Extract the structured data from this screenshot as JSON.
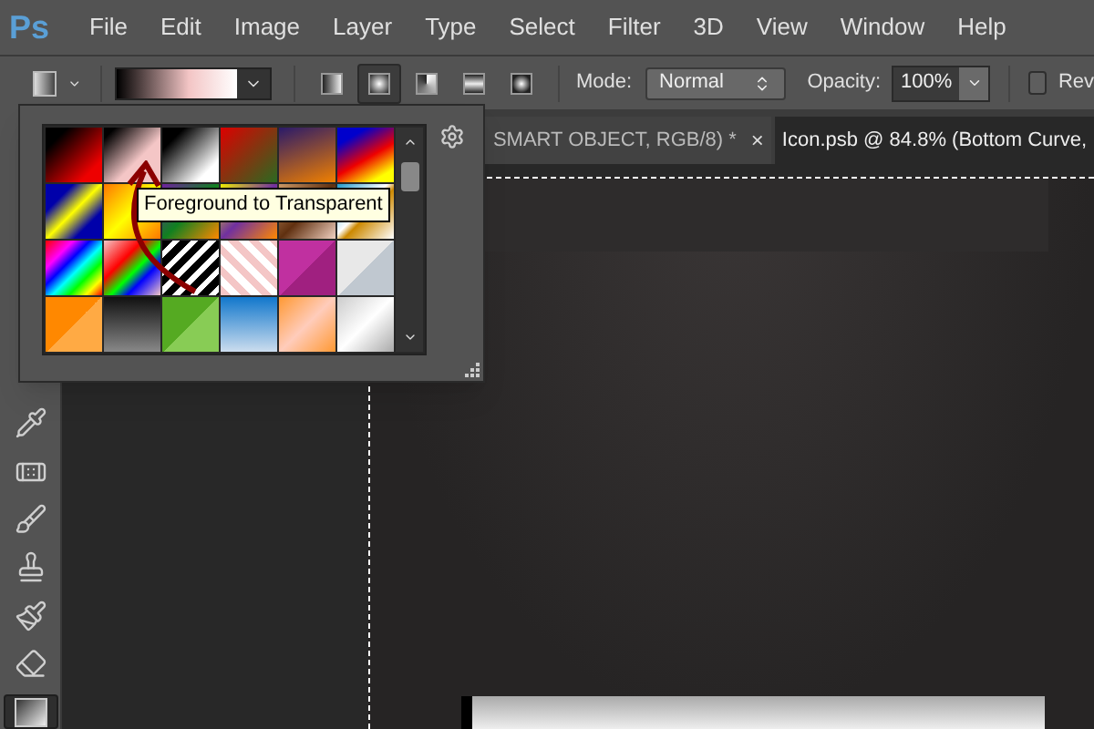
{
  "app": {
    "logo": "Ps"
  },
  "menu": [
    "File",
    "Edit",
    "Image",
    "Layer",
    "Type",
    "Select",
    "Filter",
    "3D",
    "View",
    "Window",
    "Help"
  ],
  "options_bar": {
    "gradient_types": [
      {
        "kind": "linear",
        "selected": false
      },
      {
        "kind": "radial",
        "selected": true
      },
      {
        "kind": "angle",
        "selected": false
      },
      {
        "kind": "reflected",
        "selected": false
      },
      {
        "kind": "diamond",
        "selected": false
      }
    ],
    "mode": {
      "label": "Mode:",
      "value": "Normal"
    },
    "opacity": {
      "label": "Opacity:",
      "value": "100%"
    },
    "reverse": {
      "label": "Rev",
      "checked": false
    }
  },
  "gradient_picker": {
    "tooltip": "Foreground to Transparent"
  },
  "tools": [
    {
      "kind": "eyedropper",
      "selected": false
    },
    {
      "kind": "healing",
      "selected": false
    },
    {
      "kind": "brush",
      "selected": false
    },
    {
      "kind": "stamp",
      "selected": false
    },
    {
      "kind": "history",
      "selected": false
    },
    {
      "kind": "eraser",
      "selected": false
    },
    {
      "kind": "gradient",
      "selected": true
    }
  ],
  "tabs": [
    {
      "title": "SMART OBJECT, RGB/8) *",
      "close": "×",
      "selected": false
    },
    {
      "title": "Icon.psb @ 84.8% (Bottom Curve,",
      "selected": true
    }
  ]
}
